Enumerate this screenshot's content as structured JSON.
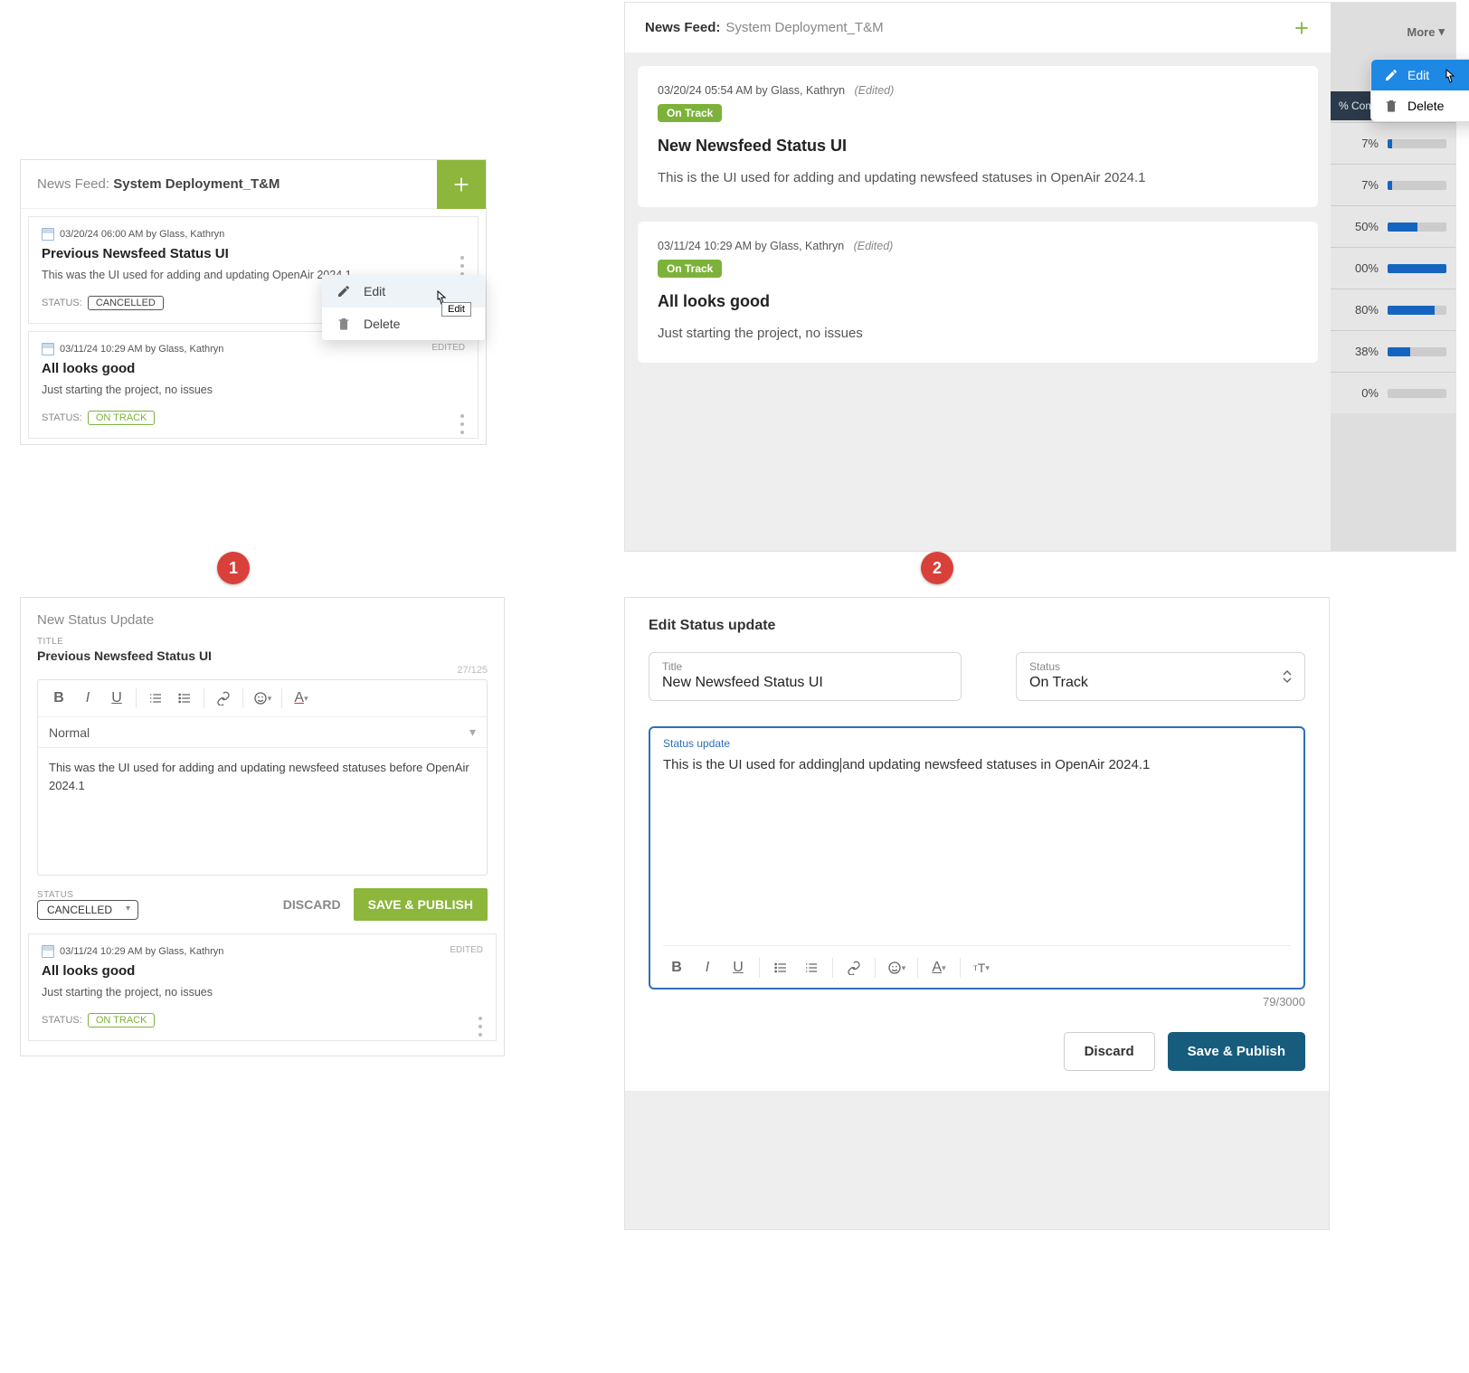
{
  "panel1": {
    "feed_label": "News Feed:",
    "project": "System Deployment_T&M",
    "card1": {
      "meta": "03/20/24 06:00 AM by Glass, Kathryn",
      "title": "Previous Newsfeed Status UI",
      "body": "This was the UI used for adding and updating OpenAir 2024.1",
      "status_label": "STATUS:",
      "status_value": "CANCELLED"
    },
    "card2": {
      "meta": "03/11/24 10:29 AM by Glass, Kathryn",
      "edited": "EDITED",
      "title": "All looks good",
      "body": "Just starting the project, no issues",
      "status_label": "STATUS:",
      "status_value": "ON TRACK"
    },
    "menu": {
      "edit": "Edit",
      "delete": "Delete",
      "tooltip": "Edit"
    }
  },
  "panel2": {
    "feed_label": "News Feed:",
    "project": "System Deployment_T&M",
    "more": "More",
    "pct_header": "% Complete",
    "rows": [
      {
        "pct": "7%"
      },
      {
        "pct": "7%"
      },
      {
        "pct": "50%"
      },
      {
        "pct": "00%"
      },
      {
        "pct": "80%"
      },
      {
        "pct": "38%"
      },
      {
        "pct": "0%"
      }
    ],
    "card1": {
      "meta": "03/20/24 05:54 AM by Glass, Kathryn",
      "edited": "(Edited)",
      "tag": "On Track",
      "title": "New Newsfeed Status UI",
      "body": "This is the UI used for adding and updating newsfeed statuses in OpenAir 2024.1"
    },
    "card2": {
      "meta": "03/11/24 10:29 AM by Glass, Kathryn",
      "edited": "(Edited)",
      "tag": "On Track",
      "title": "All looks good",
      "body": "Just starting the project, no issues"
    },
    "menu": {
      "edit": "Edit",
      "delete": "Delete"
    }
  },
  "panel3": {
    "heading": "New Status Update",
    "title_label": "TITLE",
    "title_value": "Previous Newsfeed Status UI",
    "char_count": "27/125",
    "format_option": "Normal",
    "body": "This was the UI used for adding and updating newsfeed statuses before OpenAir 2024.1",
    "status_label": "STATUS",
    "status_value": "CANCELLED",
    "discard": "DISCARD",
    "save": "SAVE & PUBLISH",
    "card": {
      "meta": "03/11/24 10:29 AM by Glass, Kathryn",
      "edited": "EDITED",
      "title": "All looks good",
      "body": "Just starting the project, no issues",
      "status_label": "STATUS:",
      "status_value": "ON TRACK"
    }
  },
  "panel4": {
    "heading": "Edit Status update",
    "title_label": "Title",
    "title_value": "New Newsfeed Status UI",
    "status_label": "Status",
    "status_value": "On Track",
    "update_label": "Status update",
    "body_before": "This is the UI used for adding",
    "body_after": "and updating newsfeed statuses in OpenAir 2024.1",
    "char_count": "79/3000",
    "discard": "Discard",
    "save": "Save & Publish"
  },
  "badges": {
    "one": "1",
    "two": "2"
  }
}
